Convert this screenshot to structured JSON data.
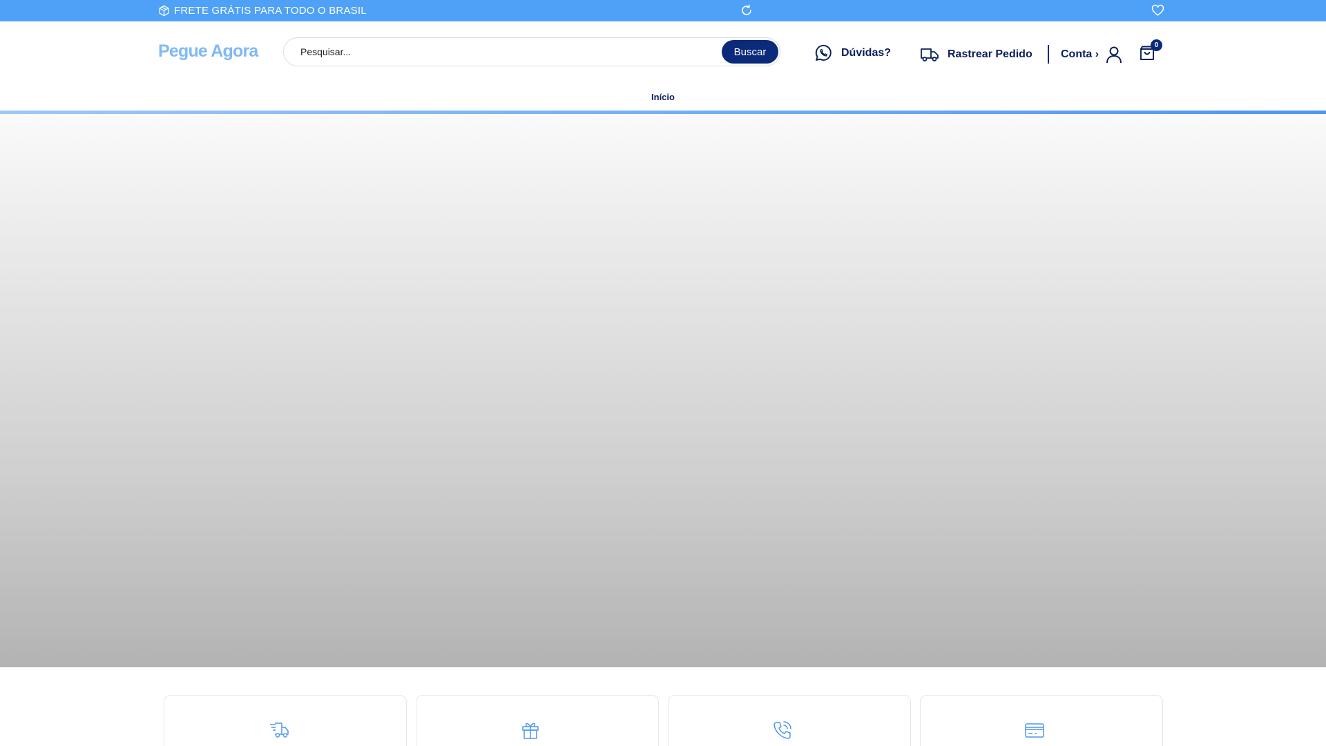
{
  "topbar": {
    "promo_text": "FRETE GRÁTIS PARA TODO O BRASIL",
    "bg_color": "#4ea1f7",
    "icons": [
      "box-icon",
      "refresh-icon",
      "heart-icon"
    ]
  },
  "header": {
    "logo_text": "Pegue Agora",
    "search": {
      "placeholder": "Pesquisar...",
      "value": "",
      "button_label": "Buscar"
    },
    "links": {
      "duvidas": "Dúvidas?",
      "rastrear": "Rastrear Pedido",
      "conta": "Conta ›"
    },
    "cart_count": "0",
    "accent_color": "#0b2a7a"
  },
  "nav": {
    "items": [
      {
        "label": "Início"
      }
    ]
  },
  "features": {
    "icons": [
      "fast-delivery-icon",
      "gift-box-icon",
      "phone-call-icon",
      "credit-card-icon"
    ]
  }
}
